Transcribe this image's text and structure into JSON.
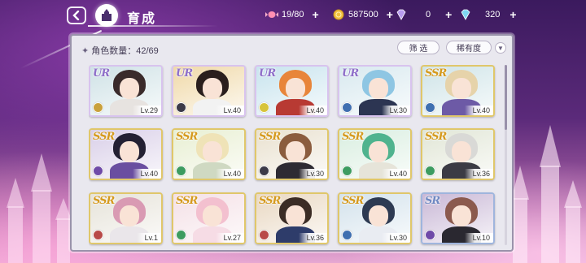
{
  "header": {
    "title": "育成",
    "back_icon": "chevron-left-icon",
    "home_icon": "castle-icon"
  },
  "resources": [
    {
      "icon": "candy-icon",
      "value": "19/80",
      "plus": "+",
      "color": "#ff8fb3"
    },
    {
      "icon": "gold-coin-icon",
      "value": "587500",
      "plus": "+",
      "color": "#f2c040"
    },
    {
      "icon": "gem-pink-icon",
      "value": "0",
      "plus": "+",
      "color": "#b99cf0"
    },
    {
      "icon": "gem-blue-icon",
      "value": "320",
      "plus": "+",
      "color": "#7fd6f0"
    }
  ],
  "panel": {
    "count_label": "角色数量：42/69",
    "filter_label": "筛 选",
    "rarity_label": "稀有度",
    "sort_icon": "chevron-down-icon"
  },
  "cards": [
    {
      "rarity": "UR",
      "level": "Lv.29",
      "elem": "#c9a13c",
      "hair": "#3a2b2b",
      "body": "#e7e3e0",
      "bg": "#cfe2e6"
    },
    {
      "rarity": "UR",
      "level": "Lv.40",
      "elem": "#3c3a48",
      "hair": "#2a1f1d",
      "body": "#f2f2f2",
      "bg": "#f0d9a8"
    },
    {
      "rarity": "UR",
      "level": "Lv.40",
      "elem": "#d7c43a",
      "hair": "#e8853a",
      "body": "#b83a33",
      "bg": "#c8e4ee"
    },
    {
      "rarity": "UR",
      "level": "Lv.30",
      "elem": "#3f6fb0",
      "hair": "#8ec6e3",
      "body": "#2c3552",
      "bg": "#d8e9ef"
    },
    {
      "rarity": "SSR",
      "level": "Lv.40",
      "elem": "#3f6fb0",
      "hair": "#e6d3aa",
      "body": "#6d5aa6",
      "bg": "#cfe4e8"
    },
    {
      "rarity": "SSR",
      "level": "Lv.40",
      "elem": "#6f4aa8",
      "hair": "#232033",
      "body": "#6a4ea0",
      "bg": "#d9cfe8"
    },
    {
      "rarity": "SSR",
      "level": "Lv.40",
      "elem": "#3d9c60",
      "hair": "#efe3b7",
      "body": "#cfd9c2",
      "bg": "#e8efd2"
    },
    {
      "rarity": "SSR",
      "level": "Lv.30",
      "elem": "#3c3a48",
      "hair": "#8b5c3e",
      "body": "#2e2b33",
      "bg": "#e9e1cf"
    },
    {
      "rarity": "SSR",
      "level": "Lv.40",
      "elem": "#3d9c60",
      "hair": "#4fb38e",
      "body": "#e6e4d9",
      "bg": "#d9eee0"
    },
    {
      "rarity": "SSR",
      "level": "Lv.36",
      "elem": "#3d9c60",
      "hair": "#d9d9d6",
      "body": "#3b3b44",
      "bg": "#e1e6d6"
    },
    {
      "rarity": "SSR",
      "level": "Lv.1",
      "elem": "#b84a48",
      "hair": "#d99ab3",
      "body": "#eae6ea",
      "bg": "#e6e3d9"
    },
    {
      "rarity": "SSR",
      "level": "Lv.27",
      "elem": "#3d9c60",
      "hair": "#f3c0cf",
      "body": "#f6dce5",
      "bg": "#f4e0e6"
    },
    {
      "rarity": "SSR",
      "level": "Lv.36",
      "elem": "#b84a48",
      "hair": "#3b2c25",
      "body": "#2e3c6a",
      "bg": "#e9d8c2"
    },
    {
      "rarity": "SSR",
      "level": "Lv.30",
      "elem": "#3f6fb0",
      "hair": "#2d3a52",
      "body": "#e9ecf2",
      "bg": "#d3e2ec"
    },
    {
      "rarity": "SR",
      "level": "Lv.10",
      "elem": "#6f4aa8",
      "hair": "#8b5a4e",
      "body": "#2a2830",
      "bg": "#c9b8d6"
    }
  ]
}
